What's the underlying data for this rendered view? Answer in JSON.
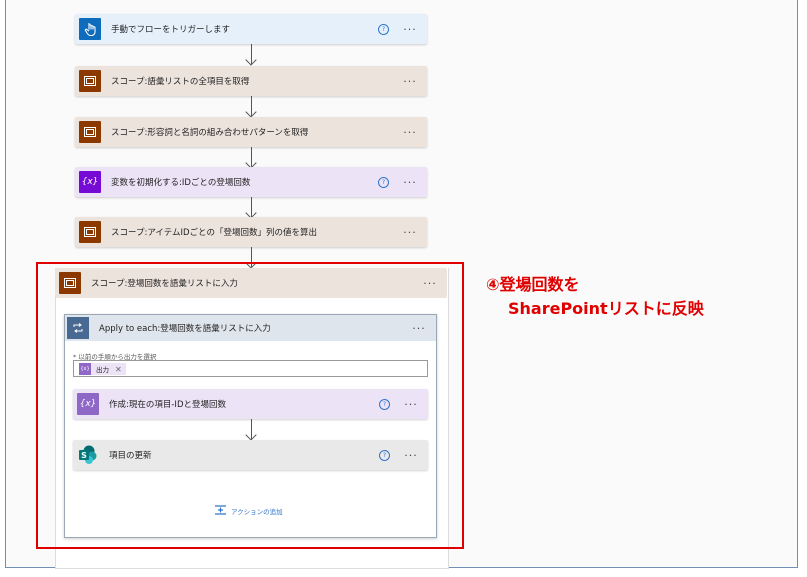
{
  "flow": {
    "steps": [
      {
        "label": "手動でフローをトリガーします",
        "icon": "manual-trigger-icon",
        "has_help": true
      },
      {
        "label": "スコープ:語彙リストの全項目を取得",
        "icon": "scope-icon",
        "has_help": false
      },
      {
        "label": "スコープ:形容詞と名詞の組み合わせパターンを取得",
        "icon": "scope-icon",
        "has_help": false
      },
      {
        "label": "変数を初期化する:IDごとの登場回数",
        "icon": "variable-icon",
        "has_help": true
      },
      {
        "label": "スコープ:アイテムIDごとの「登場回数」列の値を算出",
        "icon": "scope-icon",
        "has_help": false
      }
    ],
    "scope": {
      "label": "スコープ:登場回数を語彙リストに入力",
      "apply_each": {
        "label": "Apply to each:登場回数を語彙リストに入力",
        "select_label": "* 以前の手順から出力を選択",
        "token_label": "出力",
        "token_remove": "✕",
        "inner_steps": [
          {
            "label": "作成:現在の項目-IDと登場回数",
            "icon": "compose-icon"
          },
          {
            "label": "項目の更新",
            "icon": "sharepoint-icon"
          }
        ],
        "add_action": "アクションの追加"
      }
    },
    "more_label": "···",
    "help_label": "?"
  },
  "annotation": {
    "line1": "④登場回数を",
    "line2": "SharePointリストに反映"
  },
  "colors": {
    "trigger_blue": "#0f6cbd",
    "scope_brown": "#8c3900",
    "variable_purple": "#770bd6",
    "compose_purple": "#8e67c7",
    "loop_blue": "#486991",
    "highlight_red": "#e00000"
  }
}
